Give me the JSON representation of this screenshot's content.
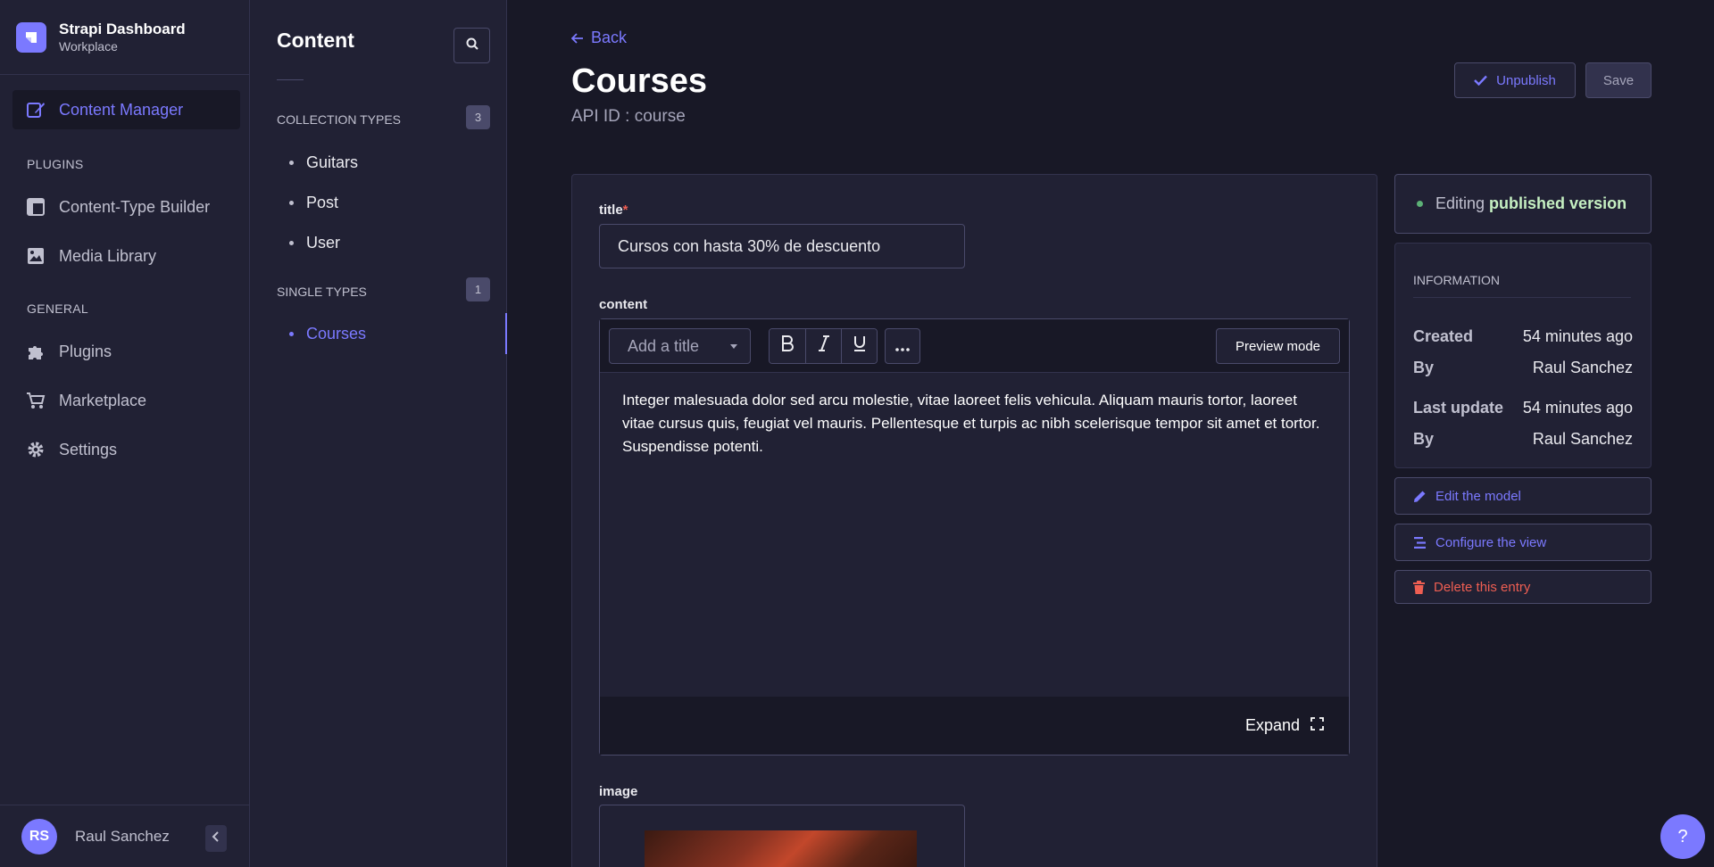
{
  "brand": {
    "title": "Strapi Dashboard",
    "subtitle": "Workplace"
  },
  "mainnav": {
    "content_manager": "Content Manager",
    "plugins_section": "PLUGINS",
    "content_type_builder": "Content-Type Builder",
    "media_library": "Media Library",
    "general_section": "GENERAL",
    "plugins": "Plugins",
    "marketplace": "Marketplace",
    "settings": "Settings"
  },
  "user": {
    "initials": "RS",
    "name": "Raul Sanchez"
  },
  "subnav": {
    "title": "Content",
    "collection_types": "COLLECTION TYPES",
    "collection_count": "3",
    "collections": [
      "Guitars",
      "Post",
      "User"
    ],
    "single_types": "SINGLE TYPES",
    "single_count": "1",
    "singles": [
      "Courses"
    ]
  },
  "header": {
    "back": "Back",
    "title": "Courses",
    "api_id": "API ID : course",
    "unpublish": "Unpublish",
    "save": "Save"
  },
  "form": {
    "title_label": "title",
    "required_mark": "*",
    "title_value": "Cursos con hasta 30% de descuento",
    "content_label": "content",
    "heading_select_placeholder": "Add a title",
    "preview_mode": "Preview mode",
    "content_text": "Integer malesuada dolor sed arcu molestie, vitae laoreet felis vehicula. Aliquam mauris tortor, laoreet vitae cursus quis, feugiat vel mauris. Pellentesque et turpis ac nibh scelerisque tempor sit amet et tortor. Suspendisse potenti.",
    "expand": "Expand",
    "image_label": "image"
  },
  "status": {
    "prefix": "Editing",
    "strong": "published version"
  },
  "information": {
    "heading": "INFORMATION",
    "created_label": "Created",
    "created_value": "54 minutes ago",
    "by_label": "By",
    "created_by": "Raul Sanchez",
    "updated_label": "Last update",
    "updated_value": "54 minutes ago",
    "updated_by": "Raul Sanchez"
  },
  "actions": {
    "edit_model": "Edit the model",
    "configure_view": "Configure the view",
    "delete_entry": "Delete this entry"
  },
  "help": "?",
  "colors": {
    "accent": "#7b79ff",
    "danger": "#ee5e52",
    "success": "#5cb176",
    "background": "#181826",
    "surface": "#212134"
  }
}
